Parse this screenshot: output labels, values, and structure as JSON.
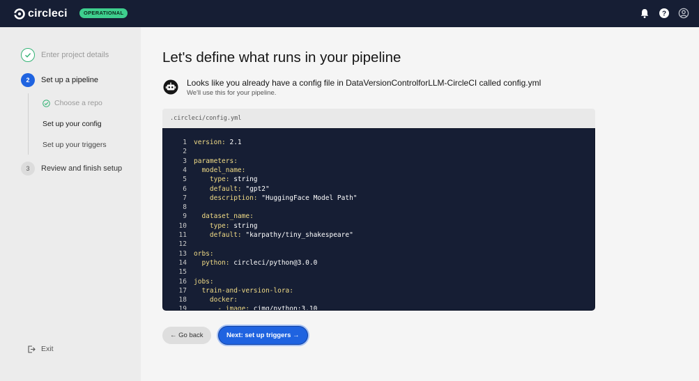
{
  "header": {
    "brand": "circleci",
    "status_badge": "OPERATIONAL",
    "icons": [
      "bell-icon",
      "help-icon",
      "user-icon"
    ]
  },
  "sidebar": {
    "steps": [
      {
        "label": "Enter project details",
        "state": "done"
      },
      {
        "label": "Set up a pipeline",
        "number": "2",
        "state": "active"
      },
      {
        "label": "Review and finish setup",
        "number": "3",
        "state": "pending"
      }
    ],
    "substeps": [
      {
        "label": "Choose a repo",
        "state": "done"
      },
      {
        "label": "Set up your config",
        "state": "active"
      },
      {
        "label": "Set up your triggers",
        "state": "pending"
      }
    ],
    "exit_label": "Exit"
  },
  "main": {
    "title": "Let's define what runs in your pipeline",
    "info_main": "Looks like you already have a config file in DataVersionControlforLLM-CircleCI called config.yml",
    "info_sub": "We'll use this for your pipeline.",
    "file_name": ".circleci/config.yml",
    "code_lines": [
      {
        "n": "1",
        "k": "version:",
        "v": " 2.1"
      },
      {
        "n": "2",
        "k": "",
        "v": ""
      },
      {
        "n": "3",
        "k": "parameters:",
        "v": ""
      },
      {
        "n": "4",
        "k": "  model_name:",
        "v": ""
      },
      {
        "n": "5",
        "k": "    type:",
        "v": " string"
      },
      {
        "n": "6",
        "k": "    default:",
        "v": " \"gpt2\""
      },
      {
        "n": "7",
        "k": "    description:",
        "v": " \"HuggingFace Model Path\""
      },
      {
        "n": "8",
        "k": "",
        "v": ""
      },
      {
        "n": "9",
        "k": "  dataset_name:",
        "v": ""
      },
      {
        "n": "10",
        "k": "    type:",
        "v": " string"
      },
      {
        "n": "11",
        "k": "    default:",
        "v": " \"karpathy/tiny_shakespeare\""
      },
      {
        "n": "12",
        "k": "",
        "v": ""
      },
      {
        "n": "13",
        "k": "orbs:",
        "v": ""
      },
      {
        "n": "14",
        "k": "  python:",
        "v": " circleci/python@3.0.0"
      },
      {
        "n": "15",
        "k": "",
        "v": ""
      },
      {
        "n": "16",
        "k": "jobs:",
        "v": ""
      },
      {
        "n": "17",
        "k": "  train-and-version-lora:",
        "v": ""
      },
      {
        "n": "18",
        "k": "    docker:",
        "v": ""
      },
      {
        "n": "19",
        "k": "      - image:",
        "v": " cimg/python:3.10"
      }
    ],
    "back_label": "← Go back",
    "next_label": "Next: set up triggers →"
  },
  "colors": {
    "topbar": "#161e34",
    "accent": "#1f63e0",
    "success": "#34b375",
    "badge": "#3ecf8e",
    "code_bg": "#161e34",
    "code_key": "#f2dc86"
  }
}
